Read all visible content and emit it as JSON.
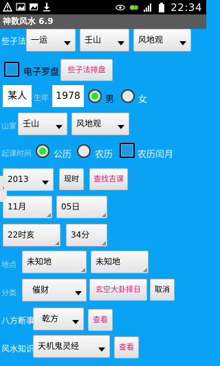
{
  "status": {
    "time": "22:34"
  },
  "app_title": "神数风水 6.9",
  "row1": {
    "label": "些子法",
    "yun": "一运",
    "shan": "壬山",
    "view": "风地观"
  },
  "row2": {
    "compass": "电子罗盘",
    "arrange_btn": "些子法排盘"
  },
  "row3": {
    "name": "某人",
    "birth_label": "生年",
    "year": "1978",
    "male": "男",
    "female": "女"
  },
  "row4": {
    "label": "山家",
    "shan": "壬山",
    "view": "风地观"
  },
  "row5": {
    "label": "起课时间",
    "solar": "公历",
    "lunar": "农历",
    "leap": "农历闰月"
  },
  "row6": {
    "year": "2013",
    "now_btn": "现时",
    "find_btn": "查找吉课"
  },
  "row7": {
    "month": "11月",
    "day": "05日"
  },
  "row8": {
    "hour": "22时亥",
    "minute": "34分"
  },
  "row9": {
    "label": "地点",
    "place1": "未知地",
    "place2": "未知地"
  },
  "row10": {
    "label": "分类",
    "category": "催财",
    "xuankong_btn": "玄空大卦择日",
    "cancel_btn": "取消"
  },
  "row11": {
    "label": "八方断事",
    "direction": "乾方",
    "view_btn": "查看"
  },
  "row12": {
    "label": "风水知识",
    "topic": "天机鬼灵经",
    "view_btn": "查看"
  }
}
